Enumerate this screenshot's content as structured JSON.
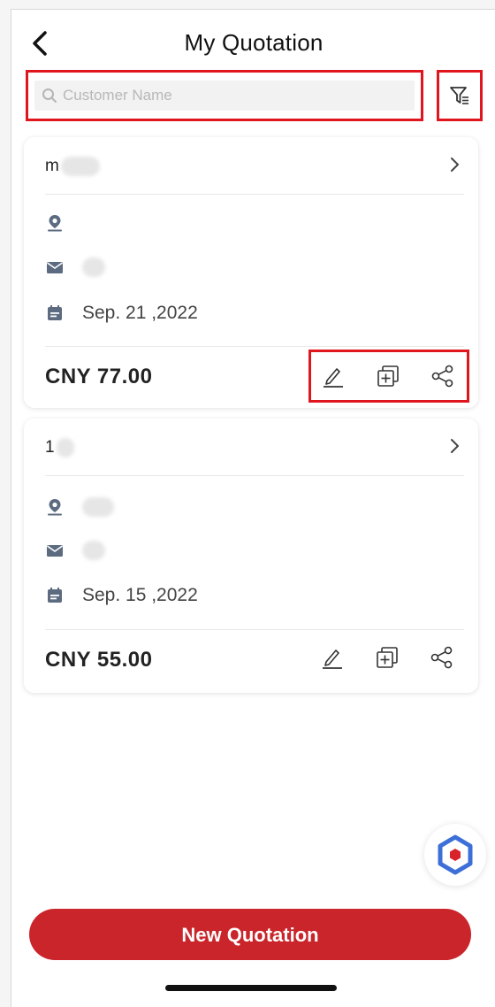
{
  "header": {
    "title": "My Quotation"
  },
  "search": {
    "placeholder": "Customer Name",
    "value": ""
  },
  "quotations": [
    {
      "customer_name": "m",
      "date": "Sep. 21 ,2022",
      "price": "CNY 77.00"
    },
    {
      "customer_name": "1",
      "date": "Sep. 15 ,2022",
      "price": "CNY 55.00"
    }
  ],
  "footer": {
    "new_button_label": "New Quotation"
  },
  "colors": {
    "accent": "#c9252b",
    "highlight_border": "#e0161e",
    "icon_gray": "#5c6b80"
  },
  "icons": {
    "back": "chevron-left-icon",
    "search": "search-icon",
    "filter": "filter-icon",
    "location": "location-pin-icon",
    "email": "mail-icon",
    "date": "calendar-icon",
    "edit": "pencil-icon",
    "copy": "copy-add-icon",
    "share": "share-icon",
    "fab": "hexagon-logo-icon"
  }
}
